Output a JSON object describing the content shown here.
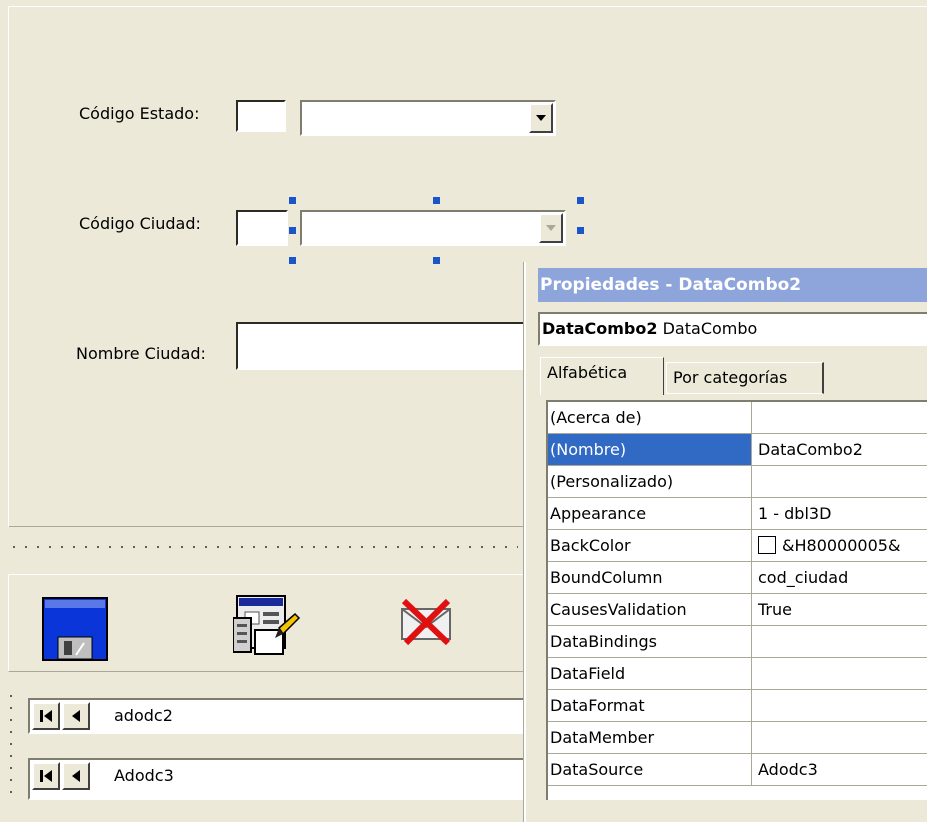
{
  "form": {
    "estado_label": "Código Estado:",
    "ciudad_label": "Código Ciudad:",
    "nombre_label": "Nombre Ciudad:"
  },
  "toolbar": {
    "save_icon": "floppy-disk-icon",
    "edit_icon": "edit-form-icon",
    "delete_icon": "delete-mail-icon"
  },
  "adodc": [
    {
      "caption": "adodc2"
    },
    {
      "caption": "Adodc3"
    }
  ],
  "properties": {
    "title": "Propiedades - DataCombo2",
    "object_name": "DataCombo2",
    "object_type": "DataCombo",
    "tabs": [
      "Alfabética",
      "Por categorías"
    ],
    "rows": [
      {
        "name": "(Acerca de)",
        "value": ""
      },
      {
        "name": "(Nombre)",
        "value": "DataCombo2"
      },
      {
        "name": "(Personalizado)",
        "value": ""
      },
      {
        "name": "Appearance",
        "value": "1 - dbl3D"
      },
      {
        "name": "BackColor",
        "value": "&H80000005&"
      },
      {
        "name": "BoundColumn",
        "value": "cod_ciudad"
      },
      {
        "name": "CausesValidation",
        "value": "True"
      },
      {
        "name": "DataBindings",
        "value": ""
      },
      {
        "name": "DataField",
        "value": ""
      },
      {
        "name": "DataFormat",
        "value": ""
      },
      {
        "name": "DataMember",
        "value": ""
      },
      {
        "name": "DataSource",
        "value": "Adodc3"
      }
    ],
    "selected_row": "(Nombre)"
  },
  "colors": {
    "face": "#ece9d8",
    "title_bar": "#8ea5dc",
    "selection": "#316ac5",
    "handle": "#1a55c9"
  }
}
